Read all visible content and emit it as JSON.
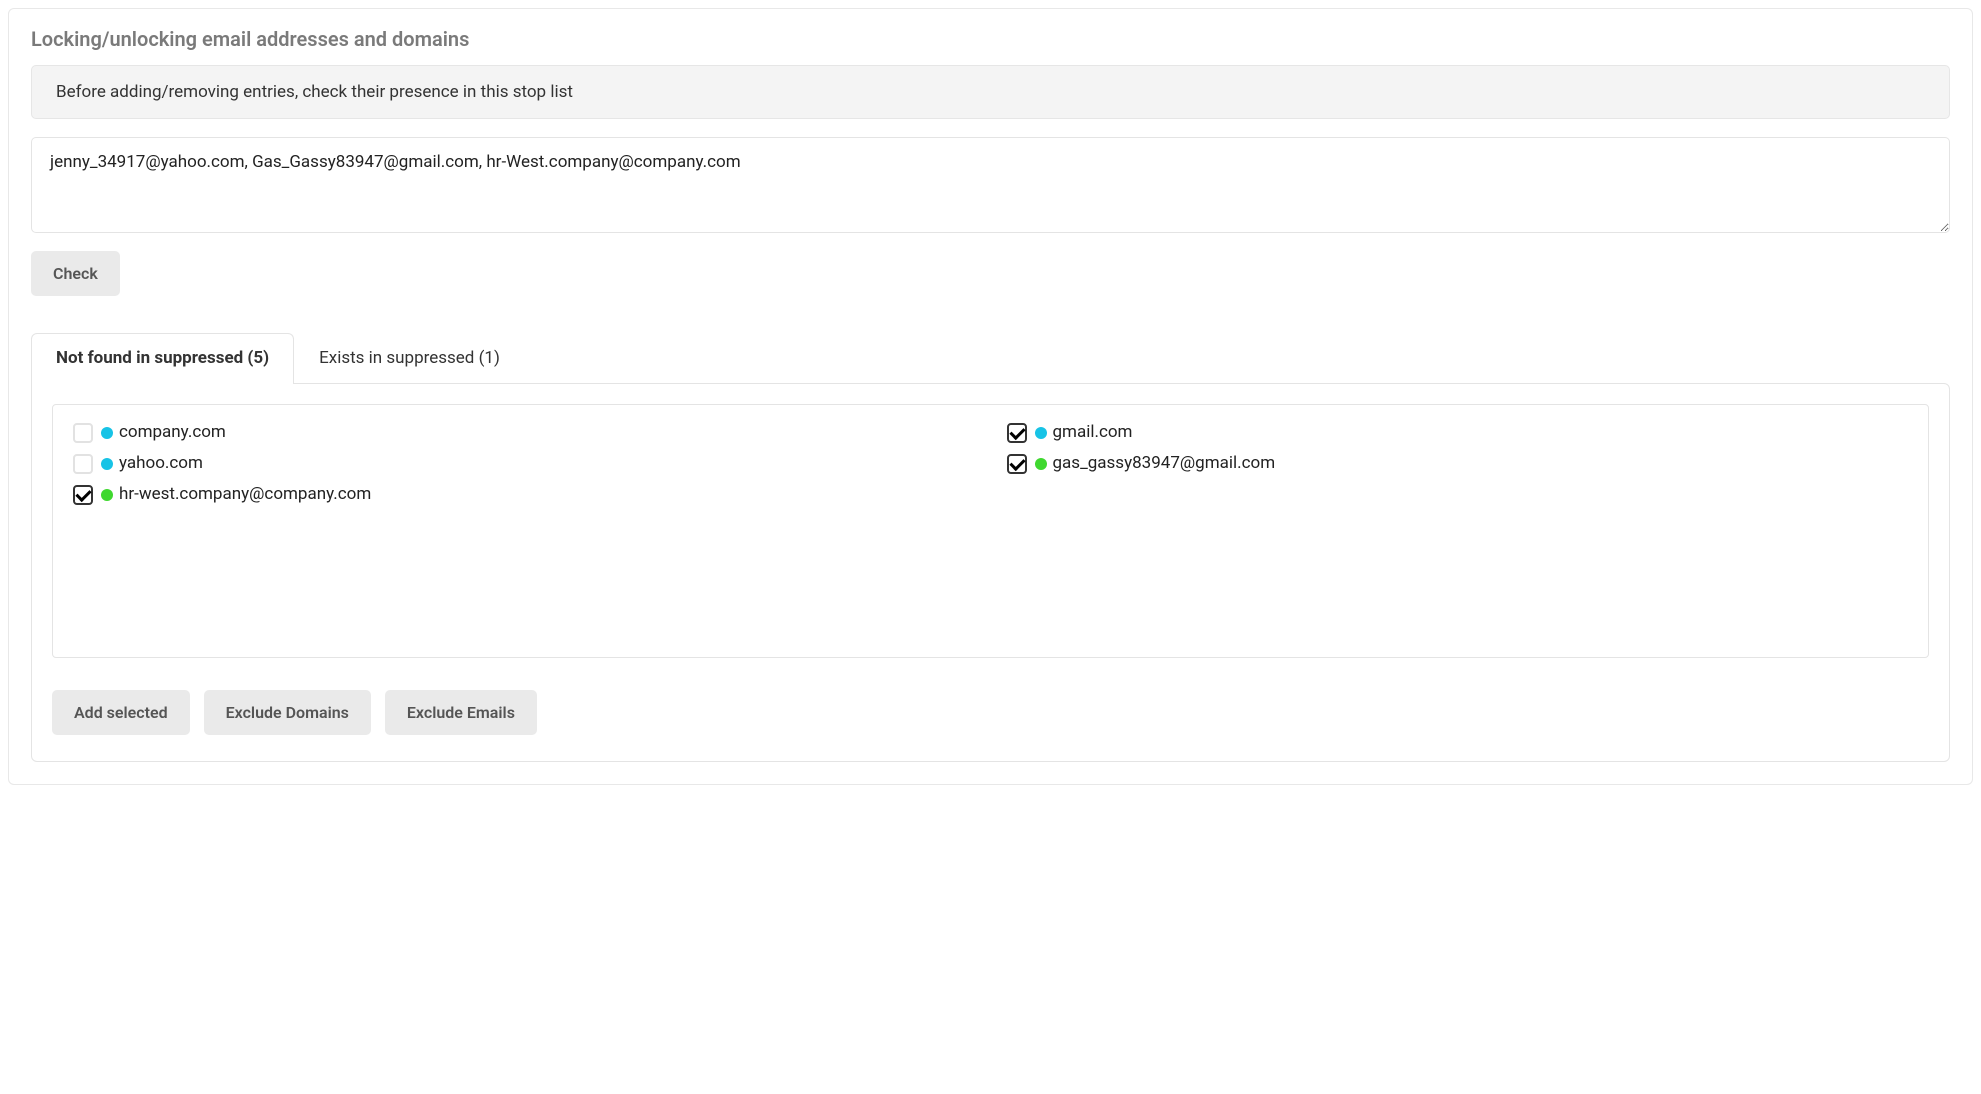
{
  "panel": {
    "title": "Locking/unlocking email addresses and domains",
    "info": "Before adding/removing entries, check their presence in this stop list",
    "input_value": "jenny_34917@yahoo.com, Gas_Gassy83947@gmail.com, hr-West.company@company.com",
    "check_label": "Check"
  },
  "tabs": {
    "not_found": {
      "label": "Not found in suppressed (5)",
      "active": true
    },
    "exists": {
      "label": "Exists in suppressed (1)",
      "active": false
    }
  },
  "results": {
    "left": [
      {
        "checked": false,
        "kind": "domain",
        "text": "company.com"
      },
      {
        "checked": false,
        "kind": "domain",
        "text": "yahoo.com"
      },
      {
        "checked": true,
        "kind": "email",
        "text": "hr-west.company@company.com"
      }
    ],
    "right": [
      {
        "checked": true,
        "kind": "domain",
        "text": "gmail.com"
      },
      {
        "checked": true,
        "kind": "email",
        "text": "gas_gassy83947@gmail.com"
      }
    ]
  },
  "actions": {
    "add_selected": "Add selected",
    "exclude_domains": "Exclude Domains",
    "exclude_emails": "Exclude Emails"
  }
}
